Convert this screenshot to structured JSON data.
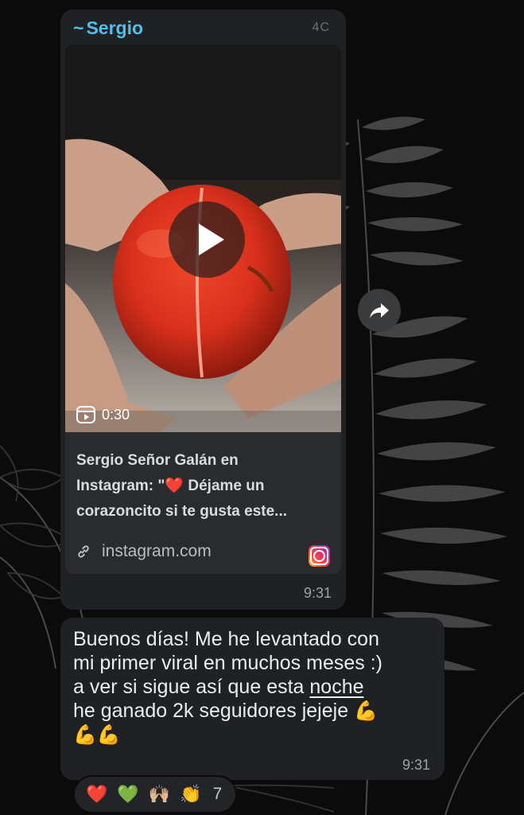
{
  "colors": {
    "background": "#0b0b0b",
    "bubble": "#202124",
    "sender": "#53bdeb",
    "heart": "#e0323a"
  },
  "message_link": {
    "sender": "Sergio",
    "sender_prefix": "~",
    "top_glyph": "4C",
    "video_duration": "0:30",
    "preview_title_line1": "Sergio Señor Galán en",
    "preview_title_line2_pre": "Instagram: \"",
    "preview_title_line2_post": " Déjame un",
    "preview_title_line3": "corazoncito si te gusta este...",
    "heart_glyph": "❤️",
    "domain": "instagram.com",
    "time": "9:31",
    "icons": [
      "play-icon",
      "reel-icon",
      "link-icon",
      "instagram-icon",
      "forward-icon"
    ]
  },
  "message_text": {
    "line1": "Buenos días! Me he levantado con",
    "line2": "mi primer viral en muchos meses :)",
    "line3_pre": "a ver si sigue así que esta ",
    "line3_link": "noche",
    "line4": "he ganado 2k seguidores jejeje ",
    "muscle_emoji": "💪",
    "time": "9:31"
  },
  "reactions": {
    "items": [
      "❤️",
      "💚",
      "🙌🏼",
      "👏"
    ],
    "count": "7"
  }
}
